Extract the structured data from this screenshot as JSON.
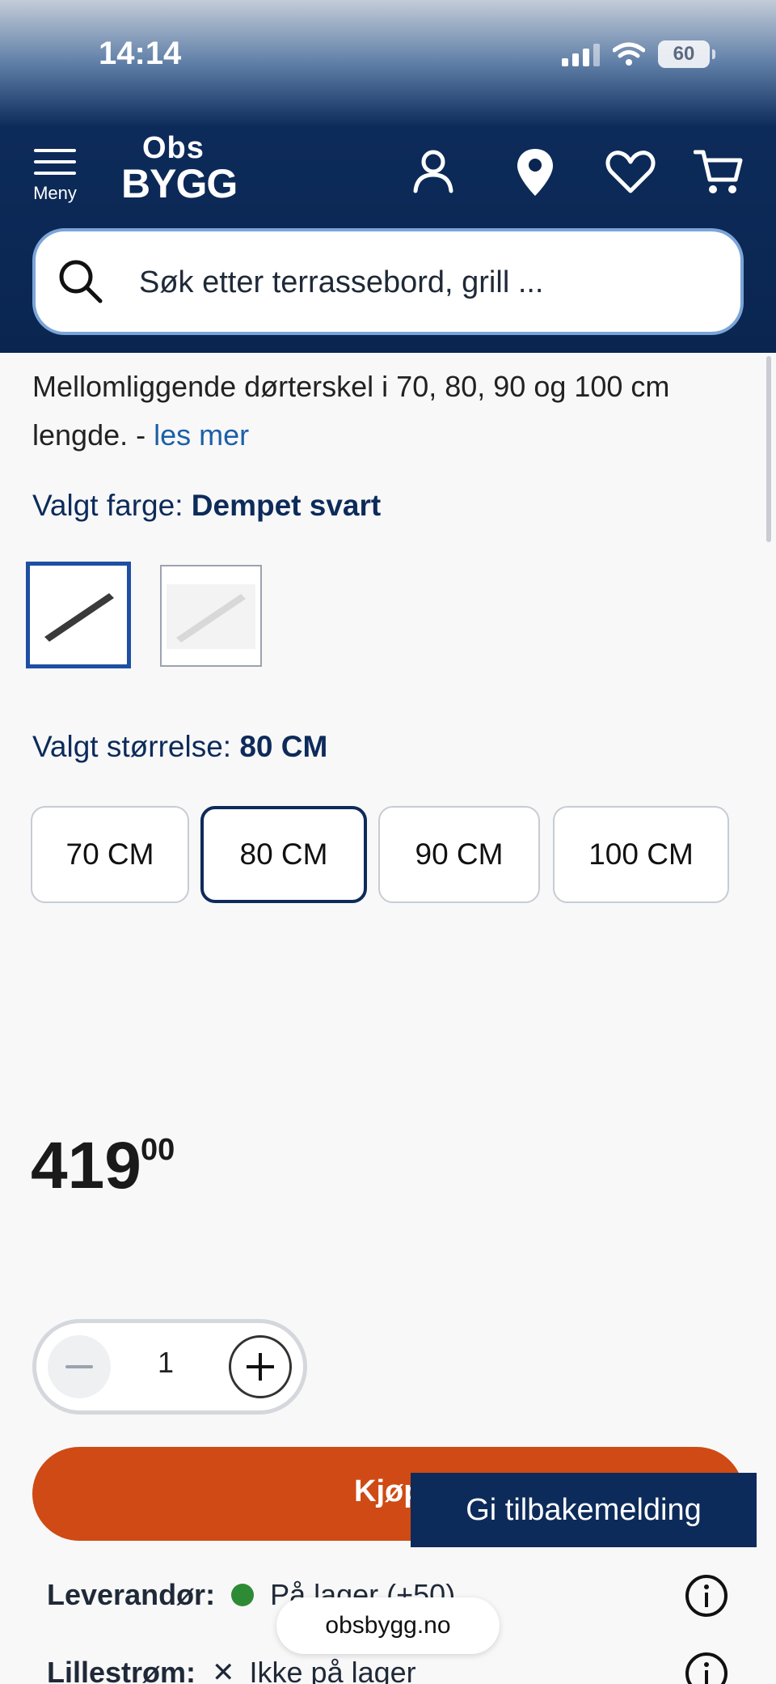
{
  "status_bar": {
    "time": "14:14",
    "battery": "60"
  },
  "header": {
    "menu_label": "Meny",
    "logo_top": "Obs",
    "logo_bottom": "BYGG",
    "icons": [
      "account-icon",
      "location-pin-icon",
      "heart-icon",
      "cart-icon"
    ]
  },
  "search": {
    "placeholder": "Søk etter terrassebord, grill ..."
  },
  "product": {
    "description": "Mellomliggende dørterskel i 70, 80, 90 og 100 cm lengde. - ",
    "read_more": "les mer",
    "color_label": "Valgt farge: ",
    "color_value": "Dempet svart",
    "size_label": "Valgt størrelse: ",
    "size_value": "80 CM",
    "sizes": [
      "70 CM",
      "80 CM",
      "90 CM",
      "100 CM"
    ],
    "price_main": "419",
    "price_decimals": "00",
    "quantity": "1",
    "buy_label": "Kjøp",
    "feedback_label": "Gi tilbakemelding"
  },
  "stock": {
    "supplier_label": "Leverandør:",
    "supplier_status": "På lager (+50)",
    "store_label": "Lillestrøm:",
    "store_status": "Ikke på lager"
  },
  "browser": {
    "url": "obsbygg.no"
  },
  "colors": {
    "header_navy": "#0a2550",
    "buy_orange": "#cf4a14",
    "link_blue": "#1d5fa6",
    "in_stock_green": "#2e8b35"
  }
}
